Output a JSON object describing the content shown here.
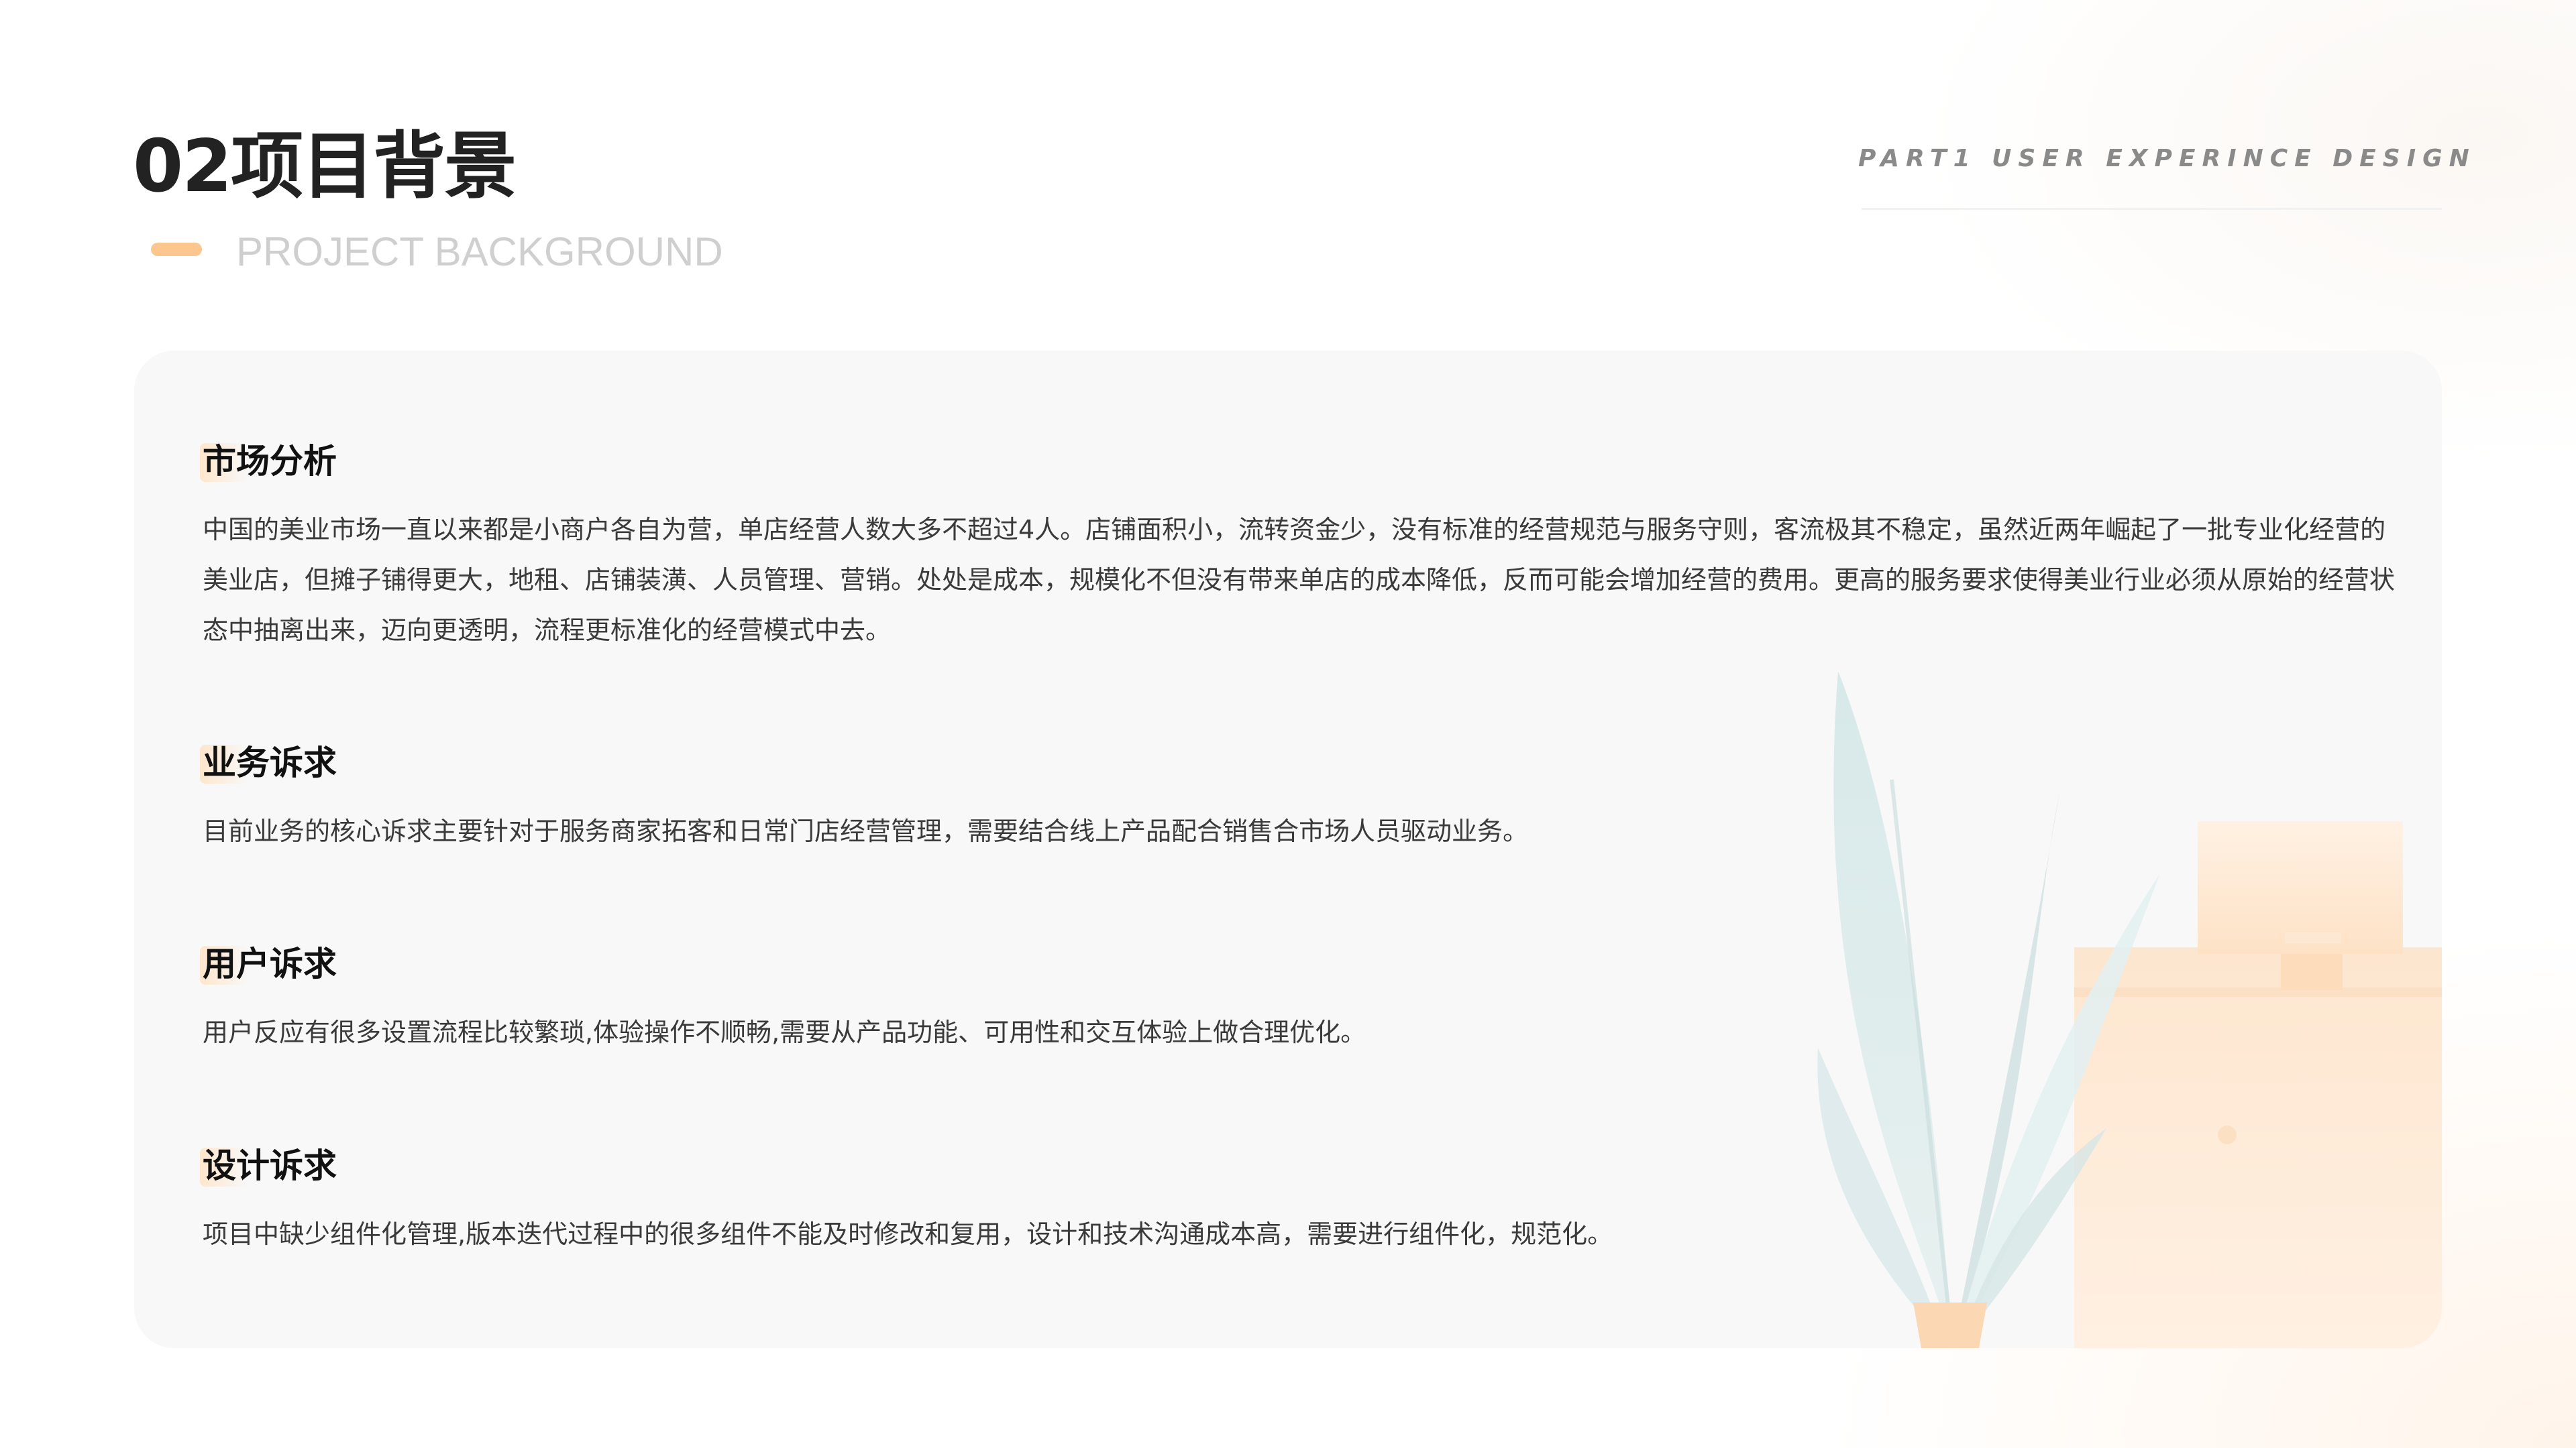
{
  "header": {
    "title": "02项目背景",
    "subtitle": "PROJECT BACKGROUND",
    "part_label": "PART1  USER EXPERINCE DESIGN"
  },
  "sections": [
    {
      "heading": "市场分析",
      "body": "中国的美业市场一直以来都是小商户各自为营，单店经营人数大多不超过4人。店铺面积小，流转资金少，没有标准的经营规范与服务守则，客流极其不稳定，虽然近两年崛起了一批专业化经营的美业店，但摊子铺得更大，地租、店铺装潢、人员管理、营销。处处是成本，规模化不但没有带来单店的成本降低，反而可能会增加经营的费用。更高的服务要求使得美业行业必须从原始的经营状态中抽离出来，迈向更透明，流程更标准化的经营模式中去。"
    },
    {
      "heading": "业务诉求",
      "body": "目前业务的核心诉求主要针对于服务商家拓客和日常门店经营管理，需要结合线上产品配合销售合市场人员驱动业务。"
    },
    {
      "heading": "用户诉求",
      "body": "用户反应有很多设置流程比较繁琐,体验操作不顺畅,需要从产品功能、可用性和交互体验上做合理优化。"
    },
    {
      "heading": "设计诉求",
      "body": "项目中缺少组件化管理,版本迭代过程中的很多组件不能及时修改和复用，设计和技术沟通成本高，需要进行组件化，规范化。"
    }
  ],
  "colors": {
    "accent": "#fcc78f",
    "card_background": "#f8f8f8",
    "plant": "#cfe3e4",
    "furniture": "#fde3c8"
  }
}
